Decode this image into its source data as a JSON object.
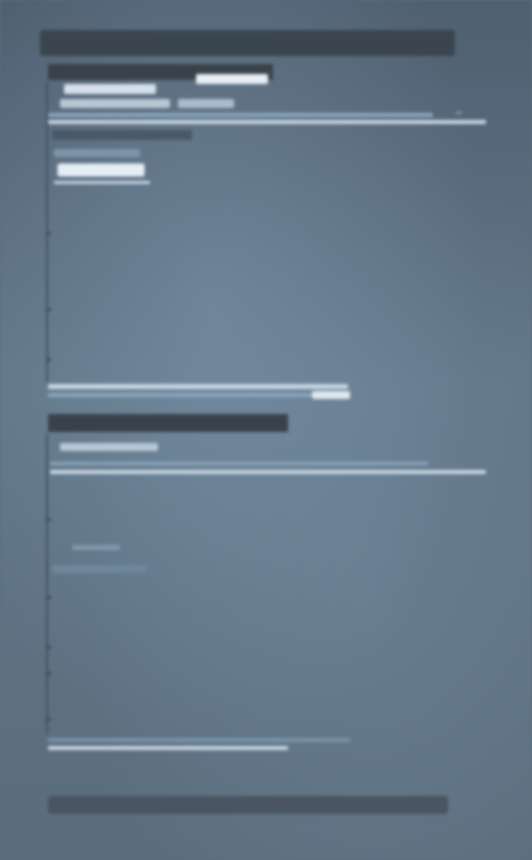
{
  "top_bar": {
    "text": ""
  },
  "section1": {
    "header": "",
    "row1": "",
    "row2_left": "",
    "row2_right": "",
    "long_row": "",
    "long_row_badge": "",
    "sub_header": "",
    "info_text": "",
    "button": ""
  },
  "section2": {
    "header": "",
    "row1": "",
    "long_row": "",
    "label_a": "",
    "label_b": ""
  },
  "bottom_bar": {
    "label": ""
  }
}
